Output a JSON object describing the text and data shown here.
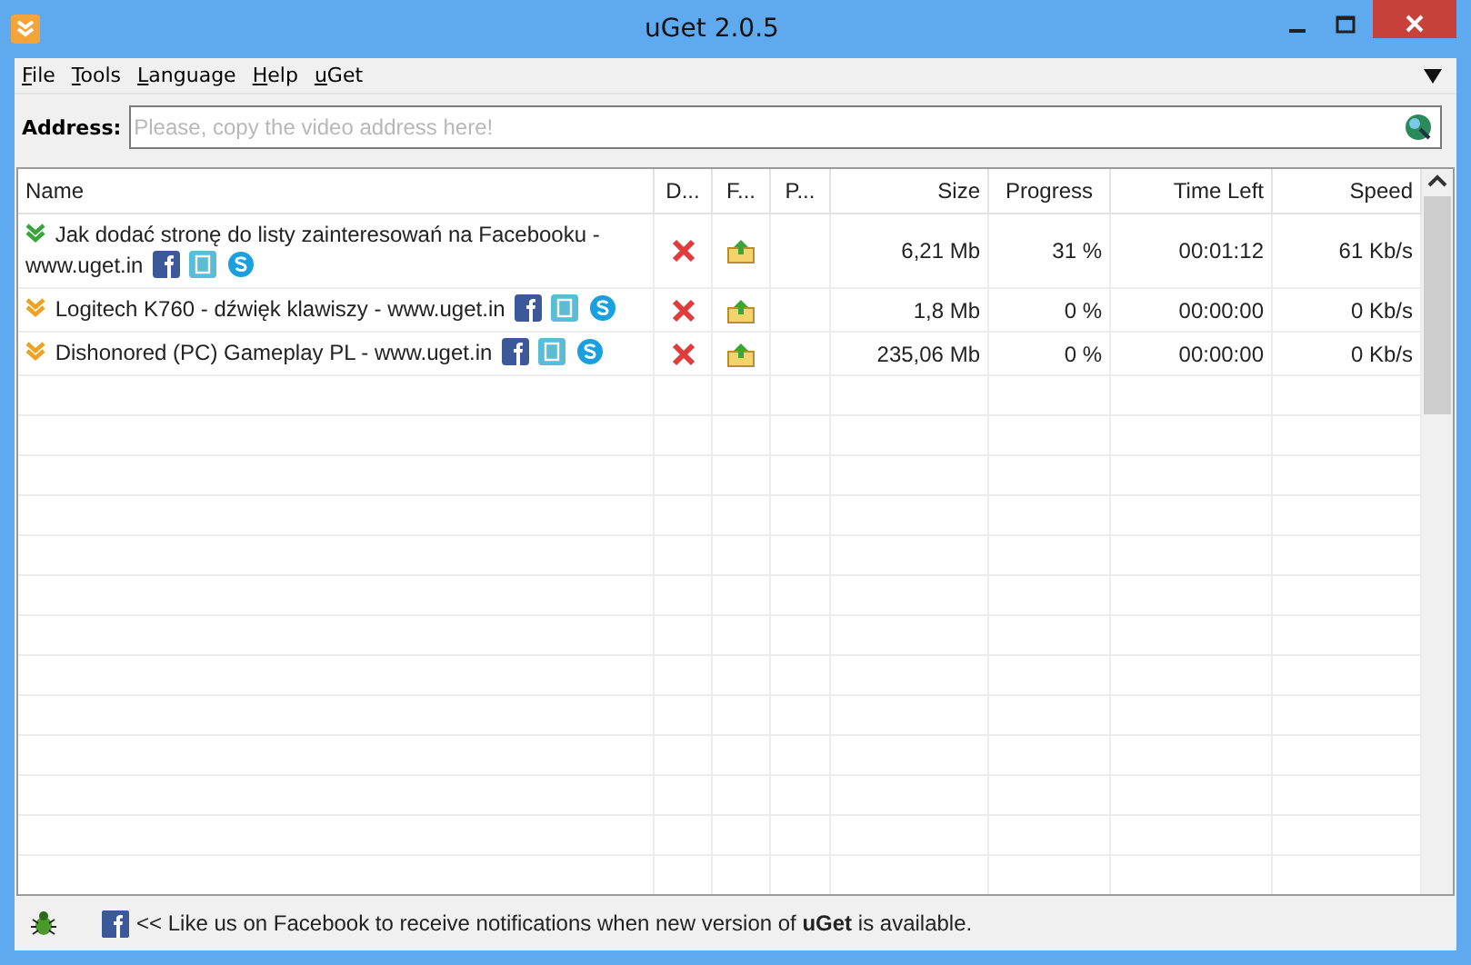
{
  "window": {
    "title": "uGet 2.0.5"
  },
  "menu": [
    "File",
    "Tools",
    "Language",
    "Help",
    "uGet"
  ],
  "address": {
    "label": "Address:",
    "placeholder": "Please, copy the video address here!"
  },
  "table": {
    "columns": [
      "Name",
      "D...",
      "F...",
      "P...",
      "Size",
      "Progress",
      "Time Left",
      "Speed"
    ],
    "rows": [
      {
        "kind": "active",
        "name": "Jak dodać stronę do listy zainteresowań na Facebooku - www.uget.in",
        "size": "6,21 Mb",
        "progress": "31 %",
        "time_left": "00:01:12",
        "speed": "61 Kb/s"
      },
      {
        "kind": "queued",
        "name": "Logitech K760 - dźwięk klawiszy - www.uget.in",
        "size": "1,8 Mb",
        "progress": "0 %",
        "time_left": "00:00:00",
        "speed": "0 Kb/s"
      },
      {
        "kind": "queued",
        "name": "Dishonored (PC) Gameplay PL - www.uget.in",
        "size": "235,06 Mb",
        "progress": "0 %",
        "time_left": "00:00:00",
        "speed": "0 Kb/s"
      }
    ]
  },
  "status_bar": {
    "message": "<< Like us on Facebook to receive notifications when new version of **uGet** is available."
  }
}
